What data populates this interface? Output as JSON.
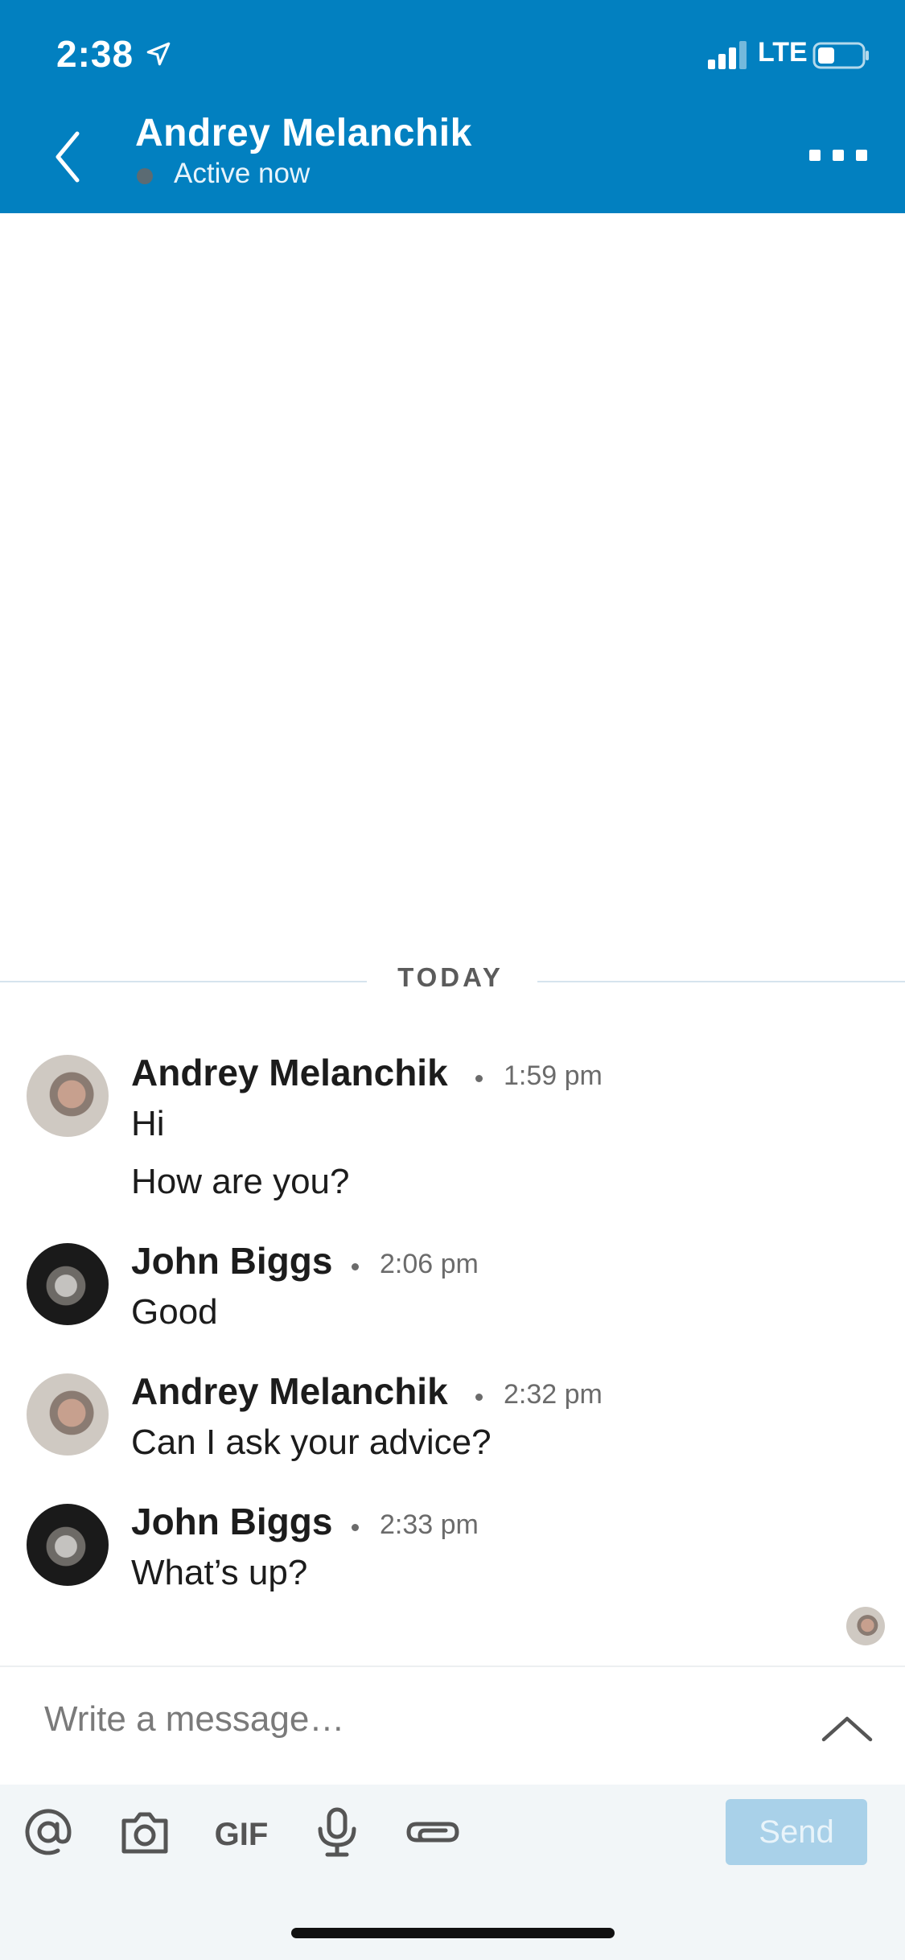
{
  "status_bar": {
    "time": "2:38",
    "network": "LTE"
  },
  "header": {
    "name": "Andrey Melanchik",
    "status": "Active now"
  },
  "divider": {
    "label": "TODAY"
  },
  "messages": [
    {
      "sender": "Andrey Melanchik",
      "time": "1:59 pm",
      "lines": [
        "Hi",
        "How are you?"
      ]
    },
    {
      "sender": "John Biggs",
      "time": "2:06 pm",
      "lines": [
        "Good"
      ]
    },
    {
      "sender": "Andrey Melanchik",
      "time": "2:32 pm",
      "lines": [
        "Can I ask your advice?"
      ]
    },
    {
      "sender": "John Biggs",
      "time": "2:33 pm",
      "lines": [
        "What’s up?"
      ]
    }
  ],
  "composer": {
    "placeholder": "Write a message…"
  },
  "toolbar": {
    "gif_label": "GIF",
    "send_label": "Send"
  },
  "colors": {
    "header": "#0280c0",
    "send_disabled": "#a9d1e9",
    "toolbar_bg": "#f2f6f8"
  },
  "icons": [
    "location-arrow-icon",
    "signal-icon",
    "battery-icon",
    "back-chevron-icon",
    "more-icon",
    "mention-icon",
    "camera-icon",
    "gif-icon",
    "microphone-icon",
    "attachment-icon",
    "chevron-up-icon"
  ]
}
